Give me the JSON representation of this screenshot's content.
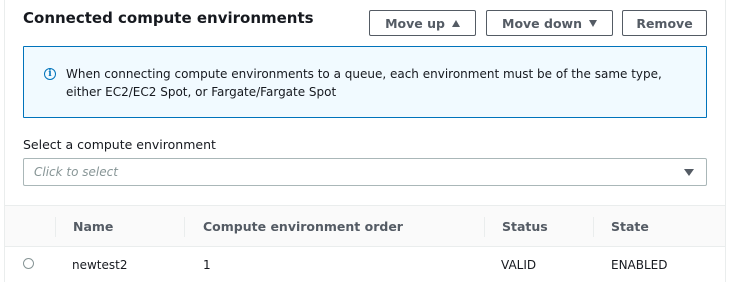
{
  "section": {
    "title": "Connected compute environments"
  },
  "toolbar": {
    "move_up_label": "Move up",
    "move_down_label": "Move down",
    "remove_label": "Remove"
  },
  "info_alert": {
    "icon": "info-icon",
    "icon_glyph": "i",
    "text": "When connecting compute environments to a queue, each environment must be of the same type, either EC2/EC2 Spot, or Fargate/Fargate Spot",
    "border_color": "#0073bb",
    "background_color": "#f1faff"
  },
  "compute_select": {
    "label": "Select a compute environment",
    "placeholder": "Click to select"
  },
  "table": {
    "columns": [
      "Name",
      "Compute environment order",
      "Status",
      "State"
    ],
    "rows": [
      {
        "name": "newtest2",
        "order": "1",
        "status": "VALID",
        "state": "ENABLED"
      }
    ]
  }
}
